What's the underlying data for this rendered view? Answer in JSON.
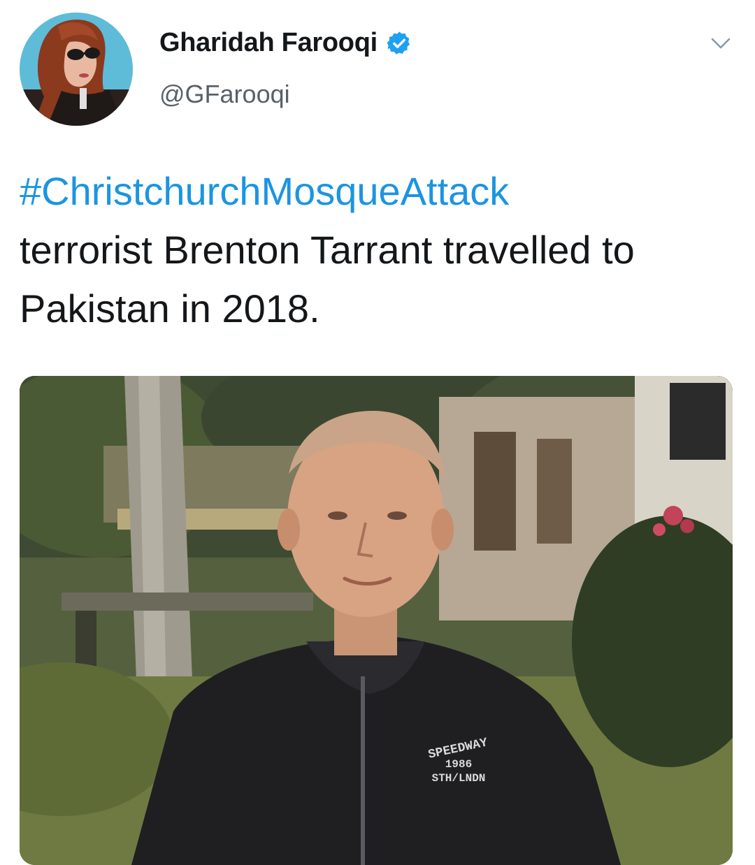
{
  "author": {
    "display_name": "Gharidah Farooqi",
    "handle": "@GFarooqi",
    "verified": true
  },
  "tweet": {
    "hashtag": "#ChristchurchMosqueAttack",
    "body": "terrorist Brenton Tarrant travelled to Pakistan in 2018."
  },
  "media": {
    "shirt_print_line1": "SPEEDWAY",
    "shirt_print_line2": "1986",
    "shirt_print_line3": "STH/LNDN"
  },
  "icons": {
    "verified": "verified-badge-icon",
    "menu": "chevron-down-icon"
  },
  "colors": {
    "link": "#1b95e0",
    "verified": "#1da1f2",
    "text": "#14171a",
    "secondary": "#586069"
  }
}
